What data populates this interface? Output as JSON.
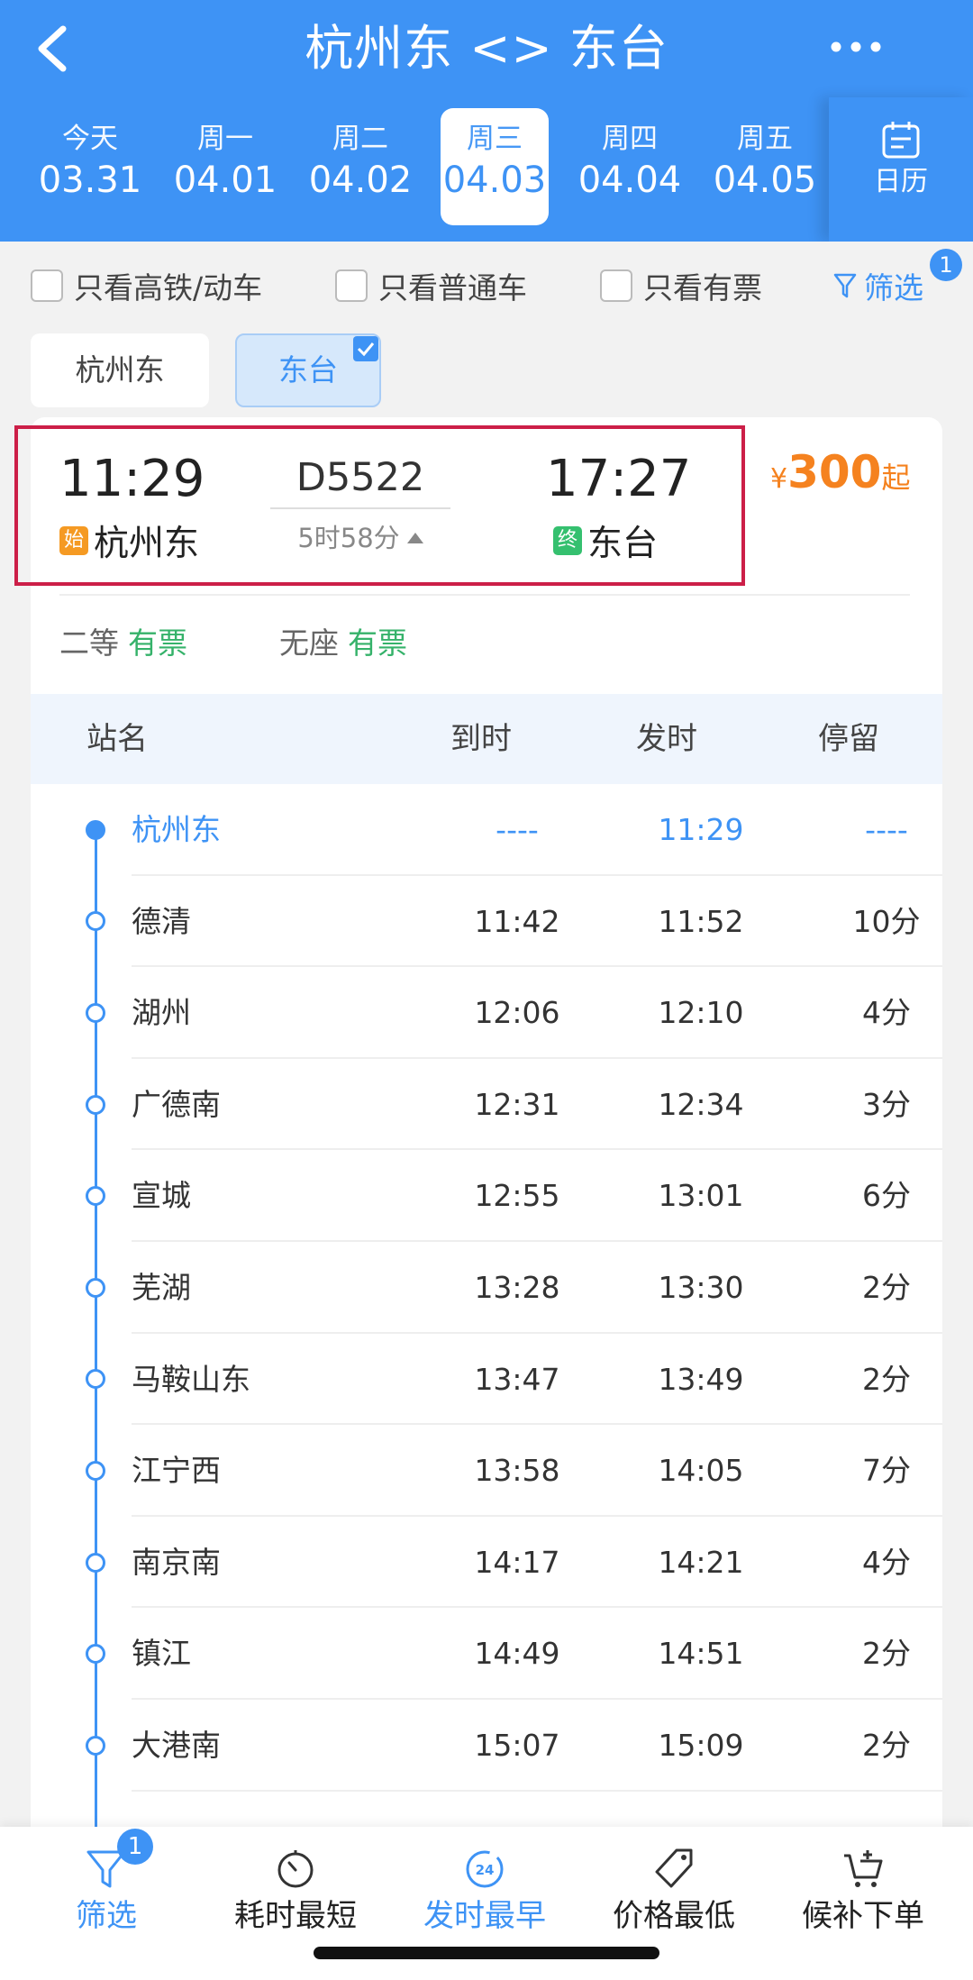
{
  "header": {
    "title": "杭州东 <> 东台",
    "dates": [
      {
        "weekday": "今天",
        "date": "03.31",
        "selected": false
      },
      {
        "weekday": "周一",
        "date": "04.01",
        "selected": false
      },
      {
        "weekday": "周二",
        "date": "04.02",
        "selected": false
      },
      {
        "weekday": "周三",
        "date": "04.03",
        "selected": true
      },
      {
        "weekday": "周四",
        "date": "04.04",
        "selected": false
      },
      {
        "weekday": "周五",
        "date": "04.05",
        "selected": false
      }
    ],
    "calendar_label": "日历"
  },
  "filters": {
    "high_speed_only": "只看高铁/动车",
    "regular_only": "只看普通车",
    "available_only": "只看有票",
    "screen_label": "筛选",
    "screen_badge": "1"
  },
  "station_chips": {
    "origin": "杭州东",
    "destination": "东台",
    "destination_selected": true
  },
  "train": {
    "departure_time": "11:29",
    "arrival_time": "17:27",
    "number": "D5522",
    "duration": "5时58分",
    "start_tag": "始",
    "end_tag": "终",
    "from_station": "杭州东",
    "to_station": "东台",
    "price_currency": "¥",
    "price_amount": "300",
    "price_suffix": "起",
    "seats": [
      {
        "class": "二等",
        "status": "有票"
      },
      {
        "class": "无座",
        "status": "有票"
      }
    ]
  },
  "stop_table": {
    "headers": {
      "station": "站名",
      "arrive": "到时",
      "depart": "发时",
      "stay": "停留"
    },
    "rows": [
      {
        "station": "杭州东",
        "arrive": "----",
        "depart": "11:29",
        "stay": "----"
      },
      {
        "station": "德清",
        "arrive": "11:42",
        "depart": "11:52",
        "stay": "10分"
      },
      {
        "station": "湖州",
        "arrive": "12:06",
        "depart": "12:10",
        "stay": "4分"
      },
      {
        "station": "广德南",
        "arrive": "12:31",
        "depart": "12:34",
        "stay": "3分"
      },
      {
        "station": "宣城",
        "arrive": "12:55",
        "depart": "13:01",
        "stay": "6分"
      },
      {
        "station": "芜湖",
        "arrive": "13:28",
        "depart": "13:30",
        "stay": "2分"
      },
      {
        "station": "马鞍山东",
        "arrive": "13:47",
        "depart": "13:49",
        "stay": "2分"
      },
      {
        "station": "江宁西",
        "arrive": "13:58",
        "depart": "14:05",
        "stay": "7分"
      },
      {
        "station": "南京南",
        "arrive": "14:17",
        "depart": "14:21",
        "stay": "4分"
      },
      {
        "station": "镇江",
        "arrive": "14:49",
        "depart": "14:51",
        "stay": "2分"
      },
      {
        "station": "大港南",
        "arrive": "15:07",
        "depart": "15:09",
        "stay": "2分"
      }
    ]
  },
  "tabbar": {
    "filter": "筛选",
    "filter_badge": "1",
    "shortest": "耗时最短",
    "earliest": "发时最早",
    "earliest_icon_text": "24",
    "cheapest": "价格最低",
    "waitlist": "候补下单"
  },
  "colors": {
    "brand_blue": "#3e93f5",
    "price_orange": "#f5821f",
    "available_green": "#35b26a",
    "highlight_red": "#cc1f48"
  }
}
